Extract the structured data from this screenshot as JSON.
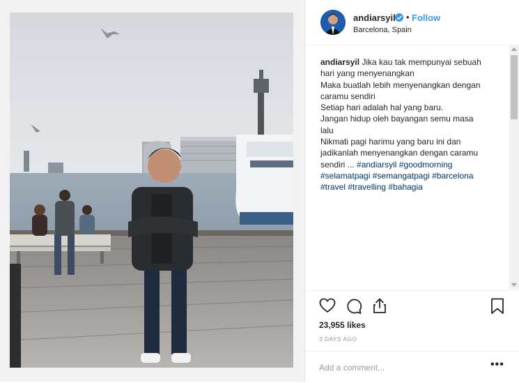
{
  "post": {
    "username": "andiarsyil",
    "follow_label": "Follow",
    "separator": "•",
    "location": "Barcelona, Spain",
    "caption": {
      "author": "andiarsyil",
      "lines": [
        "Jika kau tak mempunyai sebuah",
        "hari yang menyenangkan",
        "Maka buatlah lebih menyenangkan dengan",
        "caramu sendiri",
        "Setiap hari adalah hal yang baru.",
        "Jangan hidup oleh bayangan semu masa",
        "lalu",
        "Nikmati pagi harimu yang baru ini dan",
        "jadikanlah menyenangkan dengan caramu"
      ],
      "last_line_prefix": "sendiri ... ",
      "hashtags_line1": [
        "#andiarsyil",
        "#goodmorning"
      ],
      "hashtags_line2": [
        "#selamatpagi",
        "#semangatpagi",
        "#barcelona"
      ],
      "hashtags_line3": [
        "#travel",
        "#travelling",
        "#bahagia"
      ]
    },
    "likes": "23,955 likes",
    "date": "3 DAYS AGO",
    "comment_placeholder": "Add a comment...",
    "more_label": "•••"
  },
  "icons": {
    "verified": "verified-badge-icon",
    "like": "heart-icon",
    "comment": "comment-icon",
    "share": "share-icon",
    "save": "bookmark-icon"
  },
  "colors": {
    "link_blue": "#3897f0",
    "hashtag": "#003569",
    "text": "#262626",
    "muted": "#999999"
  }
}
